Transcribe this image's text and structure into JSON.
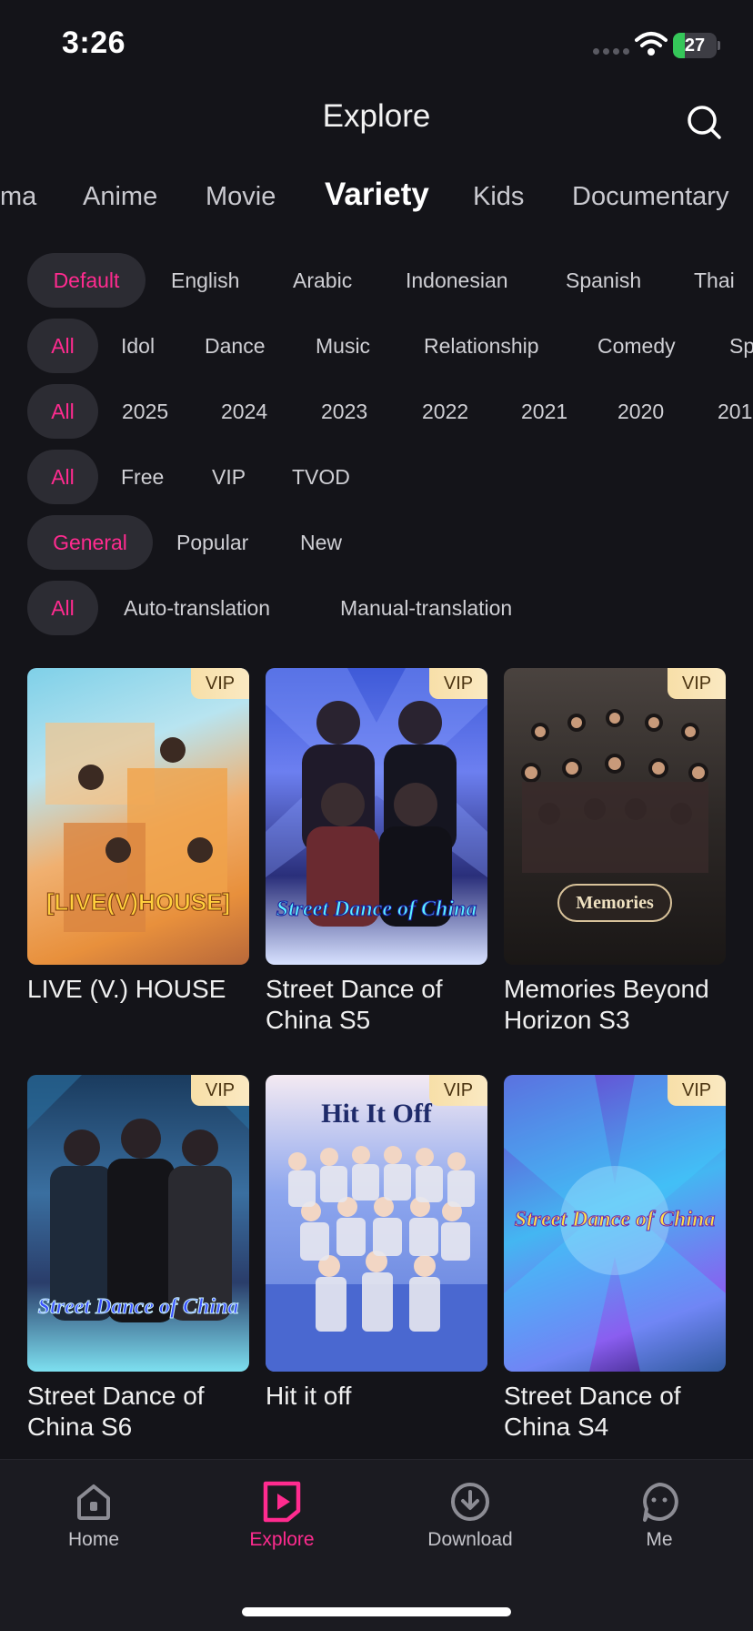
{
  "status_bar": {
    "time": "3:26",
    "battery": "27",
    "battery_level": 0.27
  },
  "header": {
    "title": "Explore"
  },
  "category_tabs": [
    "ma",
    "Anime",
    "Movie",
    "Variety",
    "Kids",
    "Documentary"
  ],
  "filters": {
    "language": [
      "Default",
      "English",
      "Arabic",
      "Indonesian",
      "Spanish",
      "Thai"
    ],
    "genre": [
      "All",
      "Idol",
      "Dance",
      "Music",
      "Relationship",
      "Comedy",
      "Sp"
    ],
    "year": [
      "All",
      "2025",
      "2024",
      "2023",
      "2022",
      "2021",
      "2020",
      "201"
    ],
    "access": [
      "All",
      "Free",
      "VIP",
      "TVOD"
    ],
    "sort": [
      "General",
      "Popular",
      "New"
    ],
    "translation": [
      "All",
      "Auto-translation",
      "Manual-translation"
    ]
  },
  "posters": [
    {
      "title": "LIVE (V.) HOUSE",
      "badge": "VIP",
      "art": "[LIVE(V)HOUSE]"
    },
    {
      "title": "Street Dance of China S5",
      "badge": "VIP",
      "art": "Street Dance of China"
    },
    {
      "title": "Memories Beyond Horizon S3",
      "badge": "VIP",
      "art": "Memories"
    },
    {
      "title": "Street Dance of China S6",
      "badge": "VIP",
      "art": "Street Dance of China"
    },
    {
      "title": "Hit it off",
      "badge": "VIP",
      "art": "Hit It Off"
    },
    {
      "title": "Street Dance of China S4",
      "badge": "VIP",
      "art": "Street Dance of China"
    }
  ],
  "nav": {
    "home": "Home",
    "explore": "Explore",
    "download": "Download",
    "me": "Me"
  },
  "colors": {
    "accent": "#ff2b8f",
    "vip_gold": "#f7dfa8",
    "background": "#141419"
  }
}
